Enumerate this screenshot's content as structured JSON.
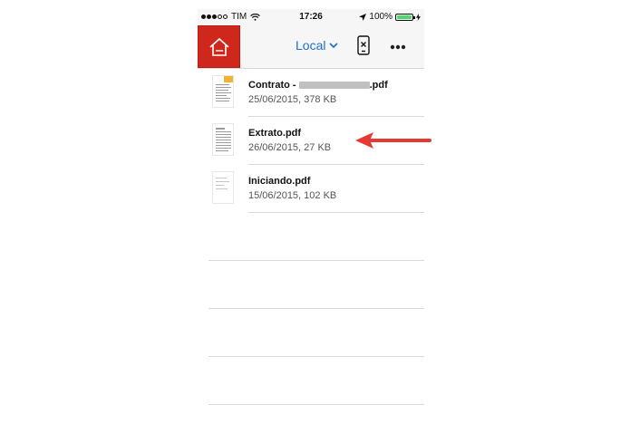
{
  "status_bar": {
    "carrier": "TIM",
    "time": "17:26",
    "battery_percent": "100%",
    "signal_bars": 5,
    "signal_filled": 3
  },
  "nav": {
    "home_icon": "home-icon",
    "location_label": "Local",
    "chevron_icon": "chevron-down-icon",
    "device_icon": "device-disconnected-icon",
    "more_icon": "more-icon",
    "accent_color": "#d0271d",
    "link_color": "#1a6fd3"
  },
  "files": [
    {
      "name_prefix": "Contrato - ",
      "name_suffix": ".pdf",
      "redacted": true,
      "meta": "25/06/2015, 378 KB",
      "thumb": "document-thumbnail"
    },
    {
      "name_prefix": "Extrato.pdf",
      "name_suffix": "",
      "redacted": false,
      "meta": "26/06/2015, 27 KB",
      "thumb": "document-thumbnail"
    },
    {
      "name_prefix": "Iniciando.pdf",
      "name_suffix": "",
      "redacted": false,
      "meta": "15/06/2015, 102 KB",
      "thumb": "document-thumbnail"
    }
  ],
  "annotation": {
    "arrow_color": "#e53935",
    "points_to": "Extrato.pdf"
  }
}
